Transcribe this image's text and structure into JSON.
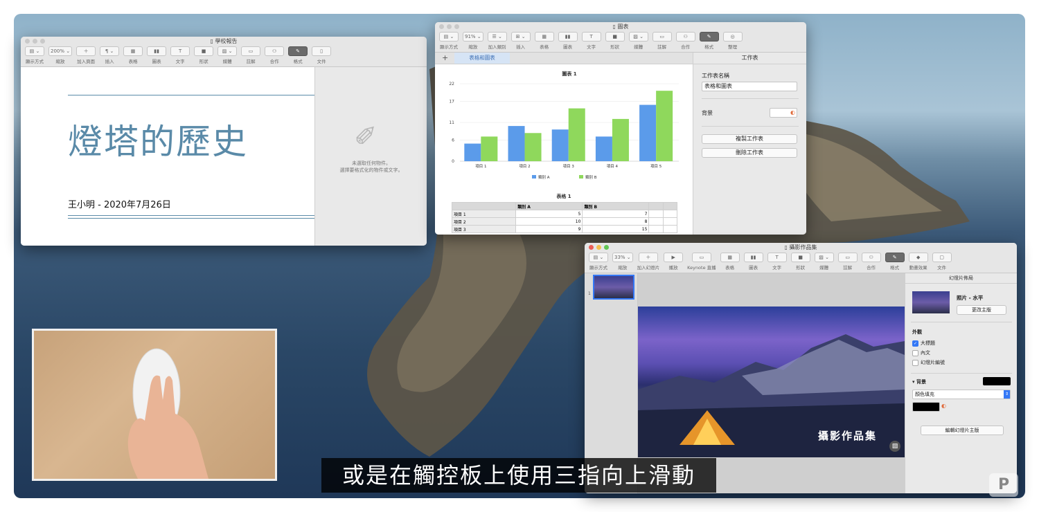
{
  "subtitle": "或是在觸控板上使用三指向上滑動",
  "pages_window": {
    "title": "學校報告",
    "toolbar": [
      {
        "icon": "view-icon",
        "btn": "▤ ⌄",
        "label": "顯示方式"
      },
      {
        "icon": "zoom-icon",
        "btn": "200% ⌄",
        "label": "縮放"
      },
      {
        "icon": "add-page-icon",
        "btn": "＋",
        "label": "加入頁面"
      },
      {
        "icon": "insert-icon",
        "btn": "¶ ⌄",
        "label": "插入"
      },
      {
        "icon": "table-icon",
        "btn": "▦",
        "label": "表格"
      },
      {
        "icon": "chart-icon",
        "btn": "▮▮",
        "label": "圖表"
      },
      {
        "icon": "text-icon",
        "btn": "T",
        "label": "文字"
      },
      {
        "icon": "shape-icon",
        "btn": "■",
        "label": "形狀"
      },
      {
        "icon": "media-icon",
        "btn": "▨ ⌄",
        "label": "媒體"
      },
      {
        "icon": "comment-icon",
        "btn": "▭",
        "label": "註解"
      },
      {
        "icon": "collaborate-icon",
        "btn": "⚇",
        "label": "合作"
      },
      {
        "icon": "format-icon",
        "btn": "✎",
        "label": "格式"
      },
      {
        "icon": "document-icon",
        "btn": "▯",
        "label": "文件"
      }
    ],
    "doc_title": "燈塔的歷史",
    "doc_author": "王小明 - 2020年7月26日",
    "inspector_line1": "未選取任何物件。",
    "inspector_line2": "選擇要格式化的物件或文字。"
  },
  "numbers_window": {
    "title": "圖表",
    "toolbar": [
      {
        "icon": "view-icon",
        "btn": "▤ ⌄",
        "label": "顯示方式"
      },
      {
        "icon": "zoom-icon",
        "btn": "91% ⌄",
        "label": "縮放"
      },
      {
        "icon": "category-icon",
        "btn": "☰ ⌄",
        "label": "加入類別"
      },
      {
        "icon": "insert-icon",
        "btn": "⊞ ⌄",
        "label": "插入"
      },
      {
        "icon": "table-icon",
        "btn": "▦",
        "label": "表格"
      },
      {
        "icon": "chart-icon",
        "btn": "▮▮",
        "label": "圖表"
      },
      {
        "icon": "text-icon",
        "btn": "T",
        "label": "文字"
      },
      {
        "icon": "shape-icon",
        "btn": "■",
        "label": "形狀"
      },
      {
        "icon": "media-icon",
        "btn": "▨ ⌄",
        "label": "媒體"
      },
      {
        "icon": "comment-icon",
        "btn": "▭",
        "label": "註解"
      },
      {
        "icon": "collaborate-icon",
        "btn": "⚇",
        "label": "合作"
      },
      {
        "icon": "format-icon",
        "btn": "✎",
        "label": "格式"
      },
      {
        "icon": "organize-icon",
        "btn": "◎",
        "label": "整理"
      }
    ],
    "add_sheet": "+",
    "sheet_tab": "表格和圖表",
    "chart_title": "圖表 1",
    "table_title": "表格 1",
    "table": {
      "headers": [
        "",
        "類別 A",
        "類別 B",
        "",
        ""
      ],
      "rows": [
        [
          "項目 1",
          "5",
          "7",
          "",
          ""
        ],
        [
          "項目 2",
          "10",
          "8",
          "",
          ""
        ],
        [
          "項目 3",
          "9",
          "15",
          "",
          ""
        ]
      ]
    },
    "inspector": {
      "header": "工作表",
      "name_label": "工作表名稱",
      "name_value": "表格和圖表",
      "background_label": "背景",
      "duplicate": "複製工作表",
      "delete": "刪除工作表"
    }
  },
  "chart_data": {
    "type": "bar",
    "title": "圖表 1",
    "categories": [
      "項目 1",
      "項目 2",
      "項目 3",
      "項目 4",
      "項目 5"
    ],
    "series": [
      {
        "name": "類別 A",
        "values": [
          5,
          10,
          9,
          7,
          16
        ],
        "color": "#5b9bea"
      },
      {
        "name": "類別 B",
        "values": [
          7,
          8,
          15,
          12,
          20
        ],
        "color": "#8fd85c"
      }
    ],
    "yticks": [
      0,
      6,
      11,
      17,
      22
    ],
    "ylim": [
      0,
      22
    ],
    "legend": "bottom"
  },
  "keynote_window": {
    "title": "攝影作品集",
    "toolbar": [
      {
        "icon": "view-icon",
        "btn": "▤ ⌄",
        "label": "顯示方式"
      },
      {
        "icon": "zoom-icon",
        "btn": "33% ⌄",
        "label": "縮放"
      },
      {
        "icon": "add-slide-icon",
        "btn": "＋",
        "label": "加入幻燈片"
      },
      {
        "icon": "play-icon",
        "btn": "▶",
        "label": "播放"
      },
      {
        "icon": "keynote-live-icon",
        "btn": "▭",
        "label": "Keynote 直播"
      },
      {
        "icon": "table-icon",
        "btn": "▦",
        "label": "表格"
      },
      {
        "icon": "chart-icon",
        "btn": "▮▮",
        "label": "圖表"
      },
      {
        "icon": "text-icon",
        "btn": "T",
        "label": "文字"
      },
      {
        "icon": "shape-icon",
        "btn": "■",
        "label": "形狀"
      },
      {
        "icon": "media-icon",
        "btn": "▨ ⌄",
        "label": "媒體"
      },
      {
        "icon": "comment-icon",
        "btn": "▭",
        "label": "註解"
      },
      {
        "icon": "collaborate-icon",
        "btn": "⚇",
        "label": "合作"
      },
      {
        "icon": "format-icon",
        "btn": "✎",
        "label": "格式"
      },
      {
        "icon": "animate-icon",
        "btn": "◆",
        "label": "動畫效果"
      },
      {
        "icon": "document-icon",
        "btn": "▢",
        "label": "文件"
      }
    ],
    "slide_number": "1",
    "slide_caption": "攝影作品集",
    "inspector": {
      "header": "幻燈片佈局",
      "layout_name": "照片 - 水平",
      "change_master": "更改主版",
      "appearance": "外觀",
      "checks": [
        {
          "label": "大標題",
          "checked": true
        },
        {
          "label": "內文",
          "checked": false
        },
        {
          "label": "幻燈片編號",
          "checked": false
        }
      ],
      "background": "背景",
      "fill": "顏色填充",
      "edit_master": "編輯幻燈片主版"
    }
  },
  "colors": {
    "accent": "#3478f6",
    "pages_title": "#5a8aa8",
    "series_a": "#5b9bea",
    "series_b": "#8fd85c"
  }
}
